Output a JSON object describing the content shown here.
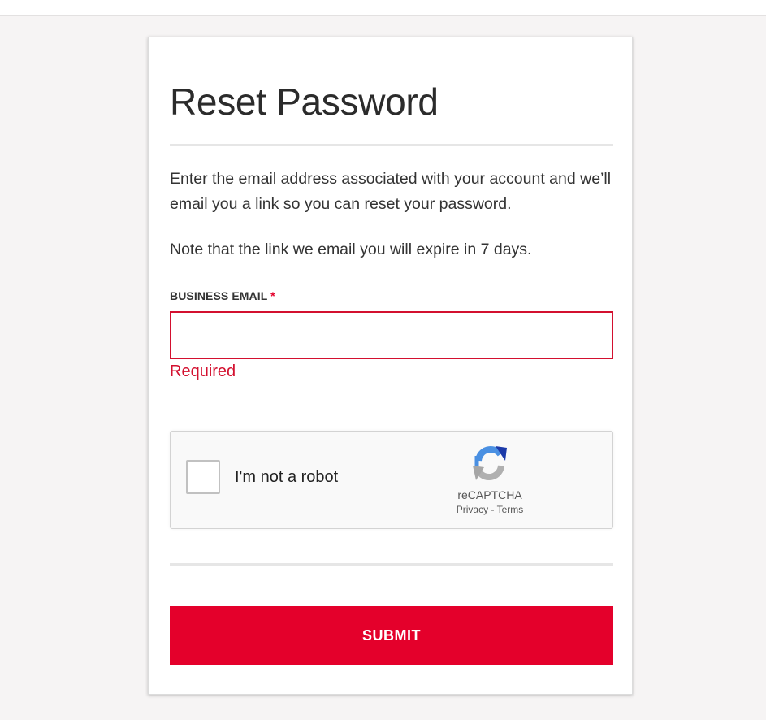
{
  "page": {
    "title": "Reset Password",
    "description": "Enter the email address associated with your account and we’ll email you a link so you can reset your password.",
    "note": "Note that the link we email you will expire in 7 days."
  },
  "form": {
    "email_label": "BUSINESS EMAIL",
    "required_marker": "*",
    "email_value": "",
    "email_error": "Required",
    "submit_label": "SUBMIT"
  },
  "captcha": {
    "checkbox_label": "I'm not a robot",
    "brand": "reCAPTCHA",
    "privacy_label": "Privacy",
    "separator": "-",
    "terms_label": "Terms",
    "checked": false
  },
  "colors": {
    "accent": "#e4002b",
    "error": "#d3102f",
    "background": "#f6f4f4",
    "card": "#ffffff",
    "text": "#333333"
  },
  "icons": {
    "captcha_logo": "recaptcha-logo-icon"
  }
}
